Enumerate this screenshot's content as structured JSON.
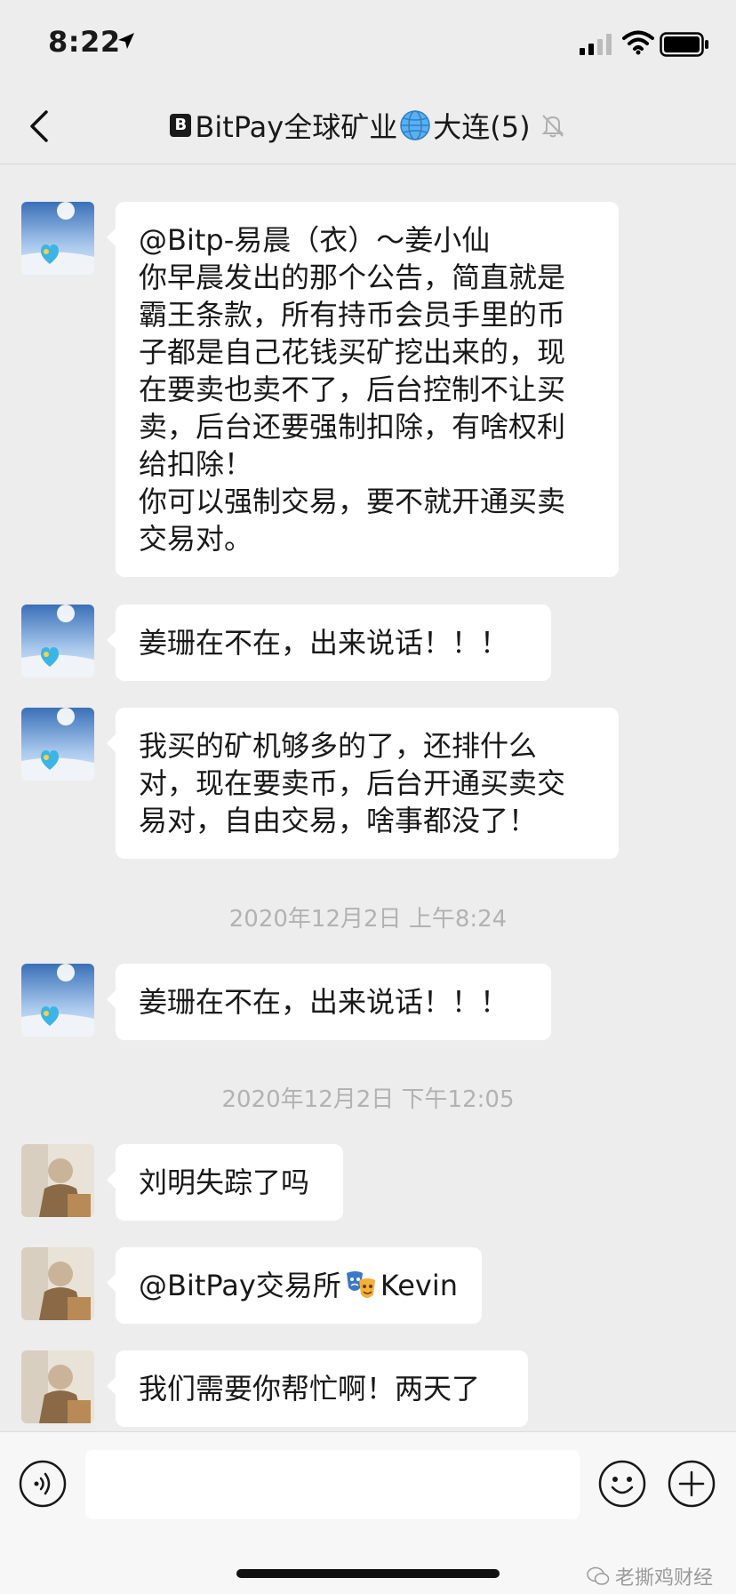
{
  "status_bar": {
    "time": "8:22"
  },
  "header": {
    "title_badge": "B",
    "title_part1": "BitPay全球矿业",
    "title_part2": "大连(5)"
  },
  "messages": [
    {
      "type": "text",
      "sender": "user1",
      "lines": [
        "@Bitp-易晨（衣）～姜小仙",
        "你早晨发出的那个公告，简直就是",
        "霸王条款，所有持币会员手里的币",
        "子都是自己花钱买矿挖出来的，现",
        "在要卖也卖不了，后台控制不让买",
        "卖，后台还要强制扣除，有啥权利",
        "给扣除！",
        "你可以强制交易，要不就开通买卖",
        "交易对。"
      ]
    },
    {
      "type": "text",
      "sender": "user1",
      "lines": [
        "姜珊在不在，出来说话！！！"
      ]
    },
    {
      "type": "text",
      "sender": "user1",
      "lines": [
        "我买的矿机够多的了，还排什么",
        "对，现在要卖币，后台开通买卖交",
        "易对，自由交易，啥事都没了！"
      ]
    },
    {
      "type": "time",
      "text": "2020年12月2日 上午8:24"
    },
    {
      "type": "text",
      "sender": "user1",
      "lines": [
        "姜珊在不在，出来说话！！！"
      ]
    },
    {
      "type": "time",
      "text": "2020年12月2日 下午12:05"
    },
    {
      "type": "text",
      "sender": "user2",
      "lines": [
        "刘明失踪了吗"
      ]
    },
    {
      "type": "text",
      "sender": "user2",
      "lines": [
        "@BitPay交易所",
        "Kevin"
      ]
    },
    {
      "type": "text",
      "sender": "user2",
      "lines": [
        "我们需要你帮忙啊！两天了"
      ]
    }
  ],
  "input": {
    "placeholder": ""
  },
  "watermark": {
    "text": "老撕鸡财经"
  },
  "icons": {
    "back": "chevron-left-icon",
    "globe": "globe-icon",
    "mute": "bell-off-icon",
    "voice": "voice-icon",
    "emoji": "emoji-icon",
    "plus": "plus-icon",
    "mask": "masks-emoji-icon"
  },
  "colors": {
    "background": "#ededed",
    "bubble": "#ffffff",
    "text": "#191919",
    "timestamp": "#b2b2b2"
  }
}
